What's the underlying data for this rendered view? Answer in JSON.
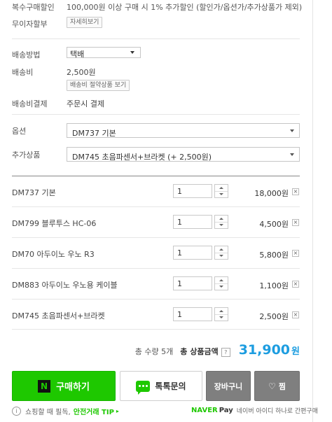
{
  "multi_discount": {
    "label": "복수구매할인",
    "text": "100,000원 이상 구매 시 1% 추가할인 (할인가/옵션가/추가상품가 제외)"
  },
  "installment": {
    "label": "무이자할부",
    "button": "자세히보기"
  },
  "shipping_method": {
    "label": "배송방법",
    "selected": "택배"
  },
  "shipping_fee": {
    "label": "배송비",
    "value": "2,500원",
    "button": "배송비 절약상품 보기"
  },
  "shipping_payment": {
    "label": "배송비결제",
    "value": "주문시 결제"
  },
  "option": {
    "label": "옵션",
    "selected": "DM737 기본"
  },
  "addon": {
    "label": "추가상품",
    "selected": "DM745 초음파센서+브라켓 (+ 2,500원)"
  },
  "items": [
    {
      "name": "DM737 기본",
      "qty": "1",
      "price": "18,000원"
    },
    {
      "name": "DM799 블루투스 HC-06",
      "qty": "1",
      "price": "4,500원"
    },
    {
      "name": "DM70 아두이노 우노 R3",
      "qty": "1",
      "price": "5,800원"
    },
    {
      "name": "DM883 아두이노 우노용 케이블",
      "qty": "1",
      "price": "1,100원"
    },
    {
      "name": "DM745 초음파센서+브라켓",
      "qty": "1",
      "price": "2,500원"
    }
  ],
  "delete_symbol": "×",
  "totals": {
    "quantity_label": "총 수량 5개",
    "amount_label": "총 상품금액",
    "help": "?",
    "amount": "31,900",
    "unit": "원"
  },
  "buttons": {
    "buy_logo": "N",
    "buy": "구매하기",
    "talk": "톡톡문의",
    "cart": "장바구니",
    "wish": "찜"
  },
  "footer": {
    "info_icon": "i",
    "safe_prefix": "쇼핑할 때 필독,",
    "safe_link": "안전거래 TIP",
    "naver": "NAVER",
    "pay": "Pay",
    "pay_desc": "네이버 아이디 하나로 간편구매"
  },
  "colors": {
    "buy_green": "#1ec800",
    "total_blue": "#1d9de0",
    "gray_button": "#7f7f7f"
  }
}
